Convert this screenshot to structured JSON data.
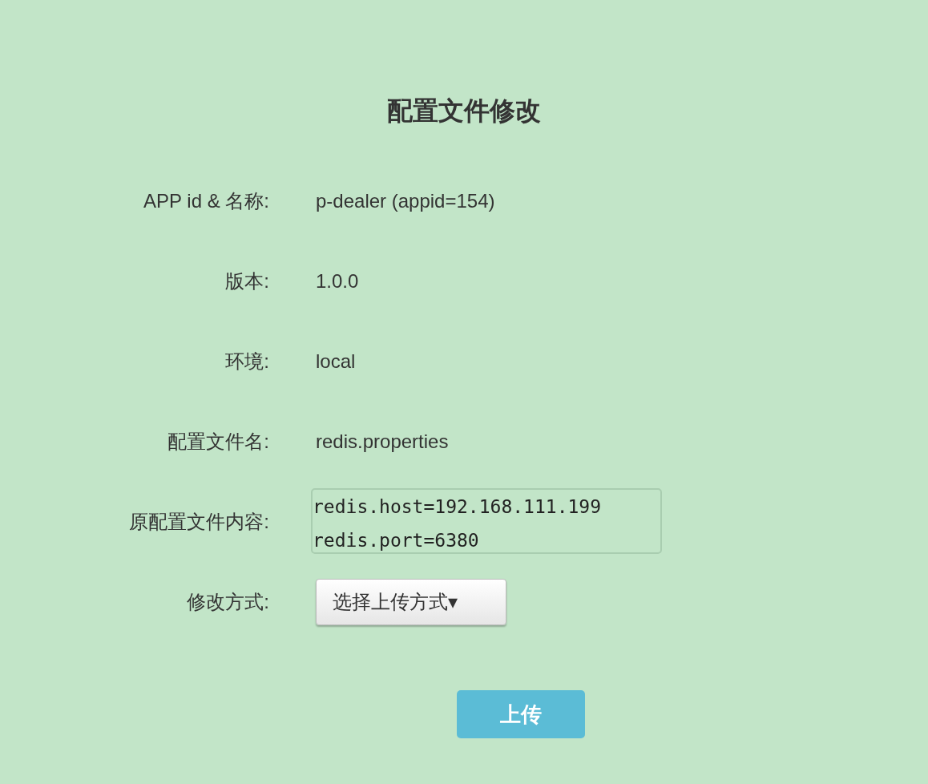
{
  "title": "配置文件修改",
  "fields": [
    {
      "label": "APP id & 名称:",
      "kind": "text",
      "value": "p-dealer (appid=154)"
    },
    {
      "label": "版本:",
      "kind": "text",
      "value": "1.0.0"
    },
    {
      "label": "环境:",
      "kind": "text",
      "value": "local"
    },
    {
      "label": "配置文件名:",
      "kind": "text",
      "value": "redis.properties"
    },
    {
      "label": "原配置文件内容:",
      "kind": "textarea",
      "value": "redis.host=192.168.111.199\nredis.port=6380"
    },
    {
      "label": "修改方式:",
      "kind": "dropdown",
      "value": "选择上传方式",
      "caret": "▾"
    }
  ],
  "submit": "上传"
}
